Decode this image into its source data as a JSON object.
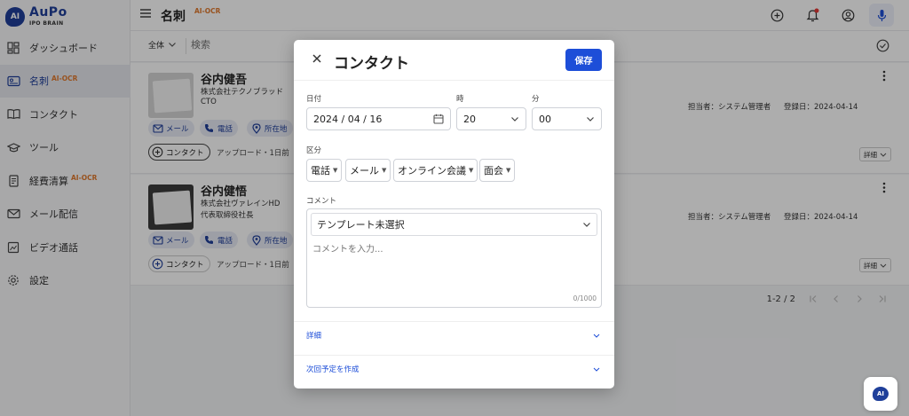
{
  "app": {
    "logo_badge": "AI",
    "logo_name": "AuPo",
    "logo_sub": "IPO BRAIN"
  },
  "sidebar": {
    "items": [
      {
        "label": "ダッシュボード",
        "icon": "dashboard-icon",
        "badge": ""
      },
      {
        "label": "名刺",
        "icon": "business-card-icon",
        "badge": "AI-OCR",
        "active": true
      },
      {
        "label": "コンタクト",
        "icon": "book-icon",
        "badge": ""
      },
      {
        "label": "ツール",
        "icon": "graduation-cap-icon",
        "badge": ""
      },
      {
        "label": "経費清算",
        "icon": "receipt-icon",
        "badge": "AI-OCR"
      },
      {
        "label": "メール配信",
        "icon": "mail-icon",
        "badge": ""
      },
      {
        "label": "ビデオ通話",
        "icon": "video-call-icon",
        "badge": ""
      },
      {
        "label": "設定",
        "icon": "gear-icon",
        "badge": ""
      }
    ]
  },
  "header": {
    "title": "名刺",
    "title_badge": "AI-OCR"
  },
  "search": {
    "filter": "全体",
    "placeholder": "検索"
  },
  "cards": [
    {
      "name": "谷内健吾",
      "company": "株式会社テクノブラッド",
      "role": "CTO",
      "chip_mail": "メール",
      "chip_phone": "電話",
      "chip_location": "所在地",
      "contact_label": "コンタクト",
      "upload_meta": "アップロード・1日前",
      "owner": "担当者：システム管理者",
      "registered": "登録日：2024-04-14",
      "detail": "詳細"
    },
    {
      "name": "谷内健悟",
      "company": "株式会社ヴァレインHD",
      "role": "代表取締役社長",
      "chip_mail": "メール",
      "chip_phone": "電話",
      "chip_location": "所在地",
      "contact_label": "コンタクト",
      "upload_meta": "アップロード・1日前",
      "owner": "担当者：システム管理者",
      "registered": "登録日：2024-04-14",
      "detail": "詳細"
    }
  ],
  "pagination": {
    "text": "1-2 / 2"
  },
  "modal": {
    "title": "コンタクト",
    "save_label": "保存",
    "date_label": "日付",
    "date_value": "2024 / 04 / 16",
    "hour_label": "時",
    "hour_value": "20",
    "minute_label": "分",
    "minute_value": "00",
    "type_label": "区分",
    "types": [
      "電話",
      "メール",
      "オンライン会議",
      "面会"
    ],
    "comment_label": "コメント",
    "template_value": "テンプレート未選択",
    "comment_placeholder": "コメントを入力...",
    "comment_counter": "0/1000",
    "detail_label": "詳細",
    "next_label": "次回予定を作成"
  },
  "colors": {
    "primary": "#1d4ed8",
    "brand": "#1f3f9a",
    "badge_orange": "#e07a2e"
  }
}
